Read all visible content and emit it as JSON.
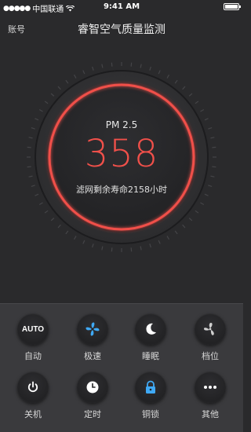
{
  "status_bar": {
    "carrier": "中国联通",
    "time": "9:41 AM",
    "battery_level": 1.0
  },
  "nav": {
    "account_label": "账号",
    "title": "睿智空气质量监测"
  },
  "gauge": {
    "metric_label": "PM 2.5",
    "value": "358",
    "filter_life_text": "滤网剩余寿命2158小时",
    "ring_color": "#f0504a"
  },
  "controls": {
    "auto": {
      "icon_text": "AUTO",
      "label": "自动",
      "icon": "auto-icon"
    },
    "turbo": {
      "label": "极速",
      "icon": "fan-icon",
      "accent": "#3fa9f5"
    },
    "sleep": {
      "label": "睡眠",
      "icon": "moon-icon"
    },
    "speed": {
      "label": "档位",
      "icon": "fan-icon"
    },
    "power": {
      "label": "关机",
      "icon": "power-icon"
    },
    "timer": {
      "label": "定时",
      "icon": "clock-icon"
    },
    "lock": {
      "label": "铜锁",
      "icon": "lock-icon",
      "accent": "#3fa9f5"
    },
    "more": {
      "label": "其他",
      "icon": "more-icon"
    }
  }
}
